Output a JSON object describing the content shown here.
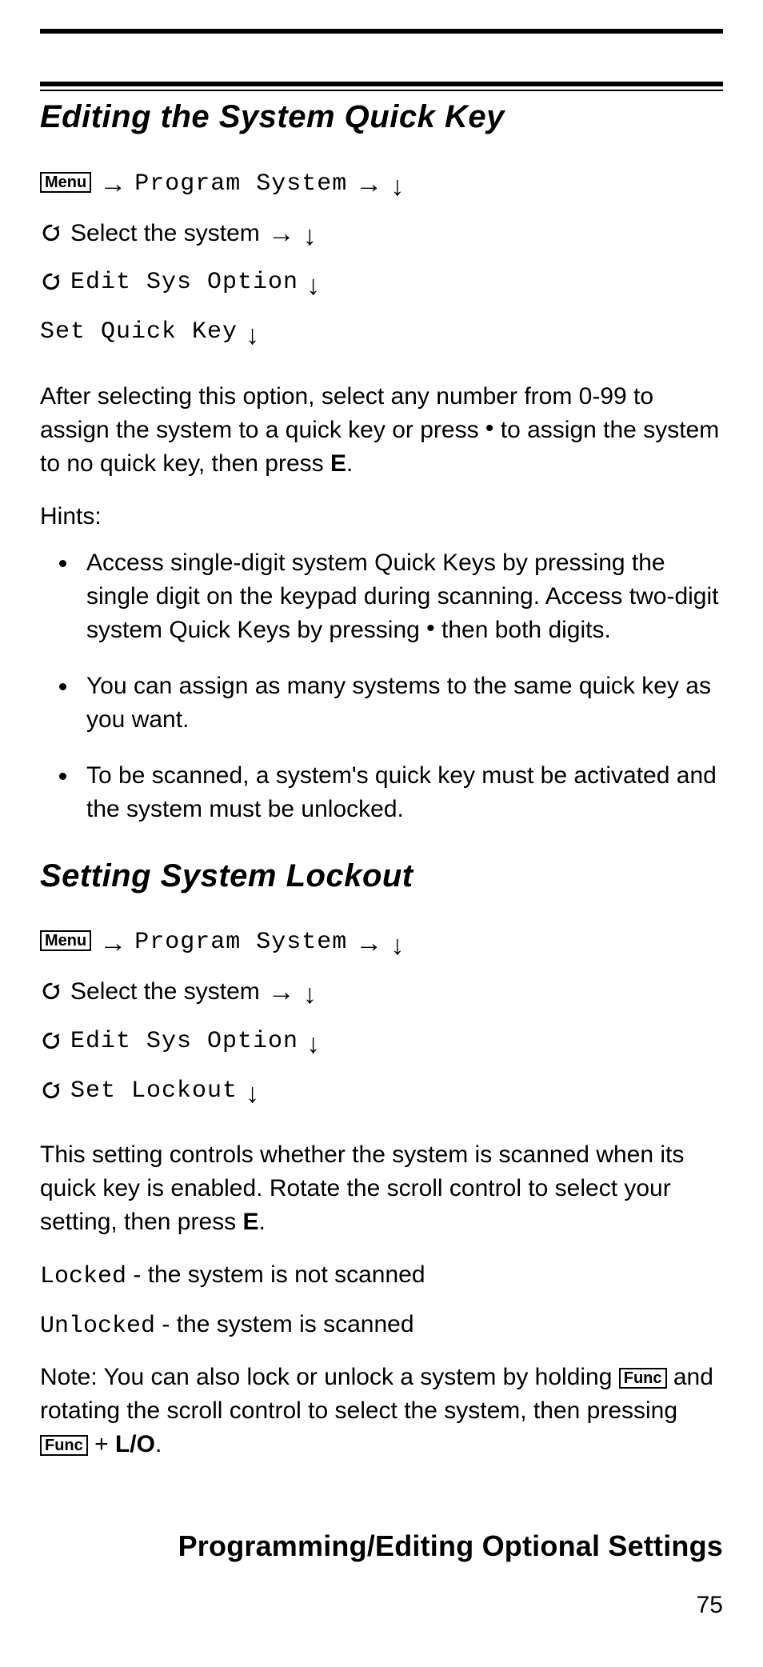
{
  "glyphs": {
    "arrowRight": "→",
    "arrowDown": "↓",
    "dot": "•"
  },
  "keys": {
    "menu": "Menu",
    "func": "Func"
  },
  "section1": {
    "title": "Editing the System Quick Key",
    "nav": {
      "line1_programSystem": "Program System",
      "line2_selectSystem": "Select the system",
      "line3_editSysOption": "Edit Sys Option",
      "line4_setQuickKey": "Set Quick Key"
    },
    "para1_a": "After selecting this option, select any number from 0-99 to assign the system to a quick key or press ",
    "para1_b": " to assign the system to no quick key, then press ",
    "para1_E": "E",
    "para1_c": ".",
    "hintsLabel": "Hints:",
    "hints": [
      {
        "pre": "Access single-digit system Quick Keys by pressing the single digit on the keypad during scanning. Access two-digit system Quick Keys by pressing ",
        "post": " then both digits."
      },
      {
        "text": "You can assign as many systems to the same quick key as you want."
      },
      {
        "text": "To be scanned, a system's quick key must be activated and the system must be unlocked."
      }
    ]
  },
  "section2": {
    "title": "Setting System Lockout",
    "nav": {
      "line1_programSystem": "Program System",
      "line2_selectSystem": "Select the system",
      "line3_editSysOption": "Edit Sys Option",
      "line4_setLockout": "Set Lockout"
    },
    "para1_a": "This setting controls whether the system is scanned when its quick key is enabled. Rotate the scroll control to select your setting, then press ",
    "para1_E": "E",
    "para1_b": ".",
    "opt1_key": "Locked",
    "opt1_desc": " - the system is not scanned",
    "opt2_key": "Unlocked",
    "opt2_desc": " - the system is scanned",
    "note_a": "Note: You can also lock or unlock a system by holding ",
    "note_b": " and rotating the scroll control to select the system, then pressing ",
    "note_c": " + ",
    "note_lo": "L/O",
    "note_d": "."
  },
  "footer": {
    "title": "Programming/Editing Optional Settings",
    "pageNumber": "75"
  }
}
